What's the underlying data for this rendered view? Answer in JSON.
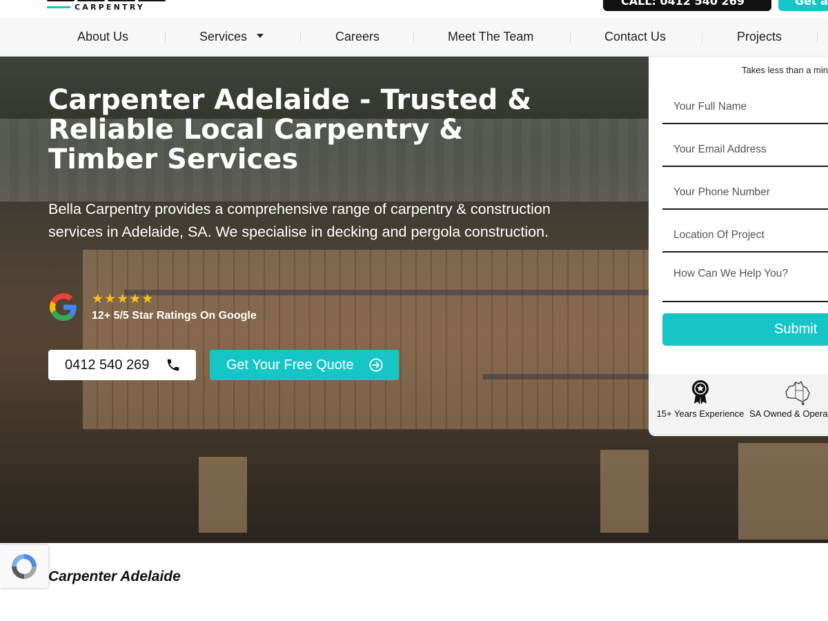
{
  "header": {
    "logo_subtitle": "CARPENTRY",
    "call_button_label": "CALL: 0412 540 269",
    "cta_button_label": "Get a Quote"
  },
  "nav": {
    "items": [
      {
        "label": "About Us"
      },
      {
        "label": "Services"
      },
      {
        "label": "Careers"
      },
      {
        "label": "Meet The Team"
      },
      {
        "label": "Contact Us"
      },
      {
        "label": "Projects"
      }
    ]
  },
  "hero": {
    "title": "Carpenter Adelaide - Trusted & Reliable Local Carpentry & Timber Services",
    "description": "Bella Carpentry provides a comprehensive range of carpentry & construction services in Adelaide, SA. We specialise in decking and pergola construction.",
    "rating_stars": "★★★★★",
    "rating_text": "12+ 5/5 Star Ratings On Google",
    "phone_label": "0412 540 269",
    "quote_label": "Get Your Free Quote"
  },
  "form": {
    "note": "Takes less than a minute",
    "full_name_placeholder": "Your Full Name",
    "email_placeholder": "Your Email Address",
    "phone_placeholder": "Your Phone Number",
    "location_placeholder": "Location Of Project",
    "message_placeholder": "How Can We Help You?",
    "submit_label": "Submit",
    "badges": [
      {
        "label": "15+ Years Experience",
        "icon": "award-icon"
      },
      {
        "label": "SA Owned & Operated",
        "icon": "australia-map-icon"
      }
    ]
  },
  "page_subtitle": "Carpenter Adelaide",
  "colors": {
    "accent": "#16c6c6",
    "dark": "#111111",
    "star": "#f7c21a"
  }
}
